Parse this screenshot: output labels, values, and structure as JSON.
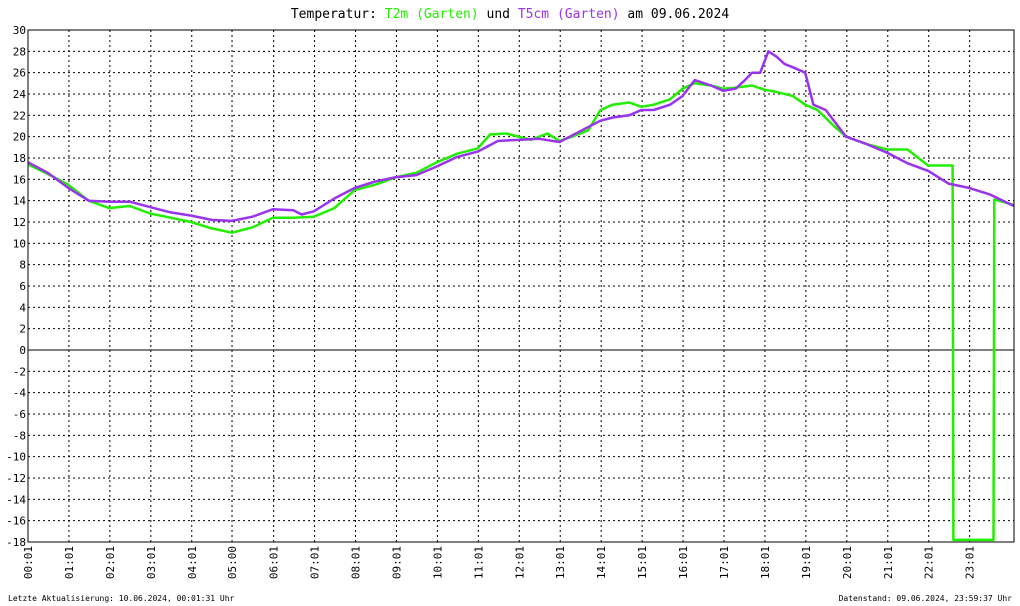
{
  "title": {
    "prefix": "Temperatur:",
    "series1": "T2m (Garten)",
    "conj": "und",
    "series2": "T5cm (Garten)",
    "suffix": "am 09.06.2024"
  },
  "footer": {
    "left": "Letzte Aktualisierung: 10.06.2024, 00:01:31 Uhr",
    "right": "Datenstand: 09.06.2024, 23:59:37 Uhr"
  },
  "colors": {
    "t2m": "#22ee00",
    "t5cm": "#9933ee",
    "grid": "#000000",
    "zero_line": "#000000"
  },
  "chart_data": {
    "type": "line",
    "xlabel": "",
    "ylabel": "",
    "xlim": [
      0.0167,
      24.1
    ],
    "ylim": [
      -18,
      30
    ],
    "grid": true,
    "legend": "title",
    "x_ticks": [
      "00:01",
      "01:01",
      "02:01",
      "03:01",
      "04:01",
      "05:00",
      "06:01",
      "07:01",
      "08:01",
      "09:01",
      "10:01",
      "11:01",
      "12:01",
      "13:01",
      "14:01",
      "15:01",
      "16:01",
      "17:01",
      "18:01",
      "19:01",
      "20:01",
      "21:01",
      "22:01",
      "23:01"
    ],
    "y_ticks": [
      30,
      28,
      26,
      24,
      22,
      20,
      18,
      16,
      14,
      12,
      10,
      8,
      6,
      4,
      2,
      0,
      -2,
      -4,
      -6,
      -8,
      -10,
      -12,
      -14,
      -16,
      -18
    ],
    "series": [
      {
        "name": "T2m (Garten)",
        "color": "#22ee00",
        "x": [
          0.02,
          0.5,
          1.0,
          1.5,
          2.0,
          2.5,
          3.0,
          3.5,
          4.0,
          4.5,
          5.0,
          5.5,
          6.0,
          6.5,
          7.0,
          7.5,
          8.0,
          8.5,
          9.0,
          9.5,
          10.0,
          10.5,
          11.0,
          11.3,
          11.7,
          12.0,
          12.3,
          12.7,
          13.0,
          13.3,
          13.7,
          14.0,
          14.3,
          14.7,
          15.0,
          15.3,
          15.7,
          16.0,
          16.3,
          16.7,
          17.0,
          17.3,
          17.7,
          18.0,
          18.3,
          18.7,
          19.0,
          19.3,
          19.7,
          20.0,
          20.5,
          21.0,
          21.2,
          21.5,
          22.0,
          22.4,
          22.6,
          22.62,
          23.0,
          23.6,
          23.62,
          24.1
        ],
        "y": [
          17.4,
          16.5,
          15.5,
          14.0,
          13.3,
          13.5,
          12.8,
          12.4,
          12.0,
          11.4,
          11.0,
          11.5,
          12.4,
          12.4,
          12.5,
          13.3,
          15.0,
          15.5,
          16.2,
          16.6,
          17.6,
          18.4,
          18.9,
          20.2,
          20.3,
          20.0,
          19.7,
          20.3,
          19.6,
          20.0,
          20.6,
          22.5,
          23.0,
          23.2,
          22.8,
          23.0,
          23.5,
          24.5,
          25.0,
          24.8,
          24.5,
          24.6,
          24.8,
          24.4,
          24.2,
          23.8,
          23.0,
          22.5,
          21.0,
          20.0,
          19.3,
          18.8,
          18.8,
          18.8,
          17.3,
          17.3,
          17.3,
          -17.8,
          -17.8,
          -17.8,
          14.1,
          13.6
        ]
      },
      {
        "name": "T5cm (Garten)",
        "color": "#9933ee",
        "x": [
          0.02,
          0.5,
          1.0,
          1.5,
          2.0,
          2.5,
          3.0,
          3.5,
          4.0,
          4.5,
          5.0,
          5.5,
          6.0,
          6.5,
          6.7,
          7.0,
          7.5,
          8.0,
          8.5,
          9.0,
          9.5,
          10.0,
          10.5,
          11.0,
          11.5,
          12.0,
          12.5,
          13.0,
          13.5,
          14.0,
          14.3,
          14.7,
          15.0,
          15.3,
          15.7,
          16.0,
          16.3,
          16.7,
          17.0,
          17.3,
          17.5,
          17.7,
          17.9,
          18.1,
          18.3,
          18.5,
          18.7,
          19.0,
          19.2,
          19.5,
          20.0,
          20.5,
          21.0,
          21.5,
          22.0,
          22.5,
          23.0,
          23.5,
          24.1
        ],
        "y": [
          17.6,
          16.6,
          15.2,
          14.0,
          13.9,
          13.9,
          13.4,
          12.9,
          12.6,
          12.2,
          12.1,
          12.5,
          13.2,
          13.1,
          12.7,
          13.0,
          14.2,
          15.2,
          15.8,
          16.2,
          16.4,
          17.2,
          18.1,
          18.6,
          19.6,
          19.7,
          19.8,
          19.5,
          20.5,
          21.5,
          21.8,
          22.0,
          22.5,
          22.5,
          23.0,
          23.8,
          25.3,
          24.8,
          24.3,
          24.5,
          25.2,
          26.0,
          26.0,
          28.0,
          27.5,
          26.8,
          26.5,
          26.0,
          23.0,
          22.5,
          20.0,
          19.3,
          18.5,
          17.5,
          16.8,
          15.6,
          15.2,
          14.6,
          13.5
        ]
      }
    ]
  }
}
